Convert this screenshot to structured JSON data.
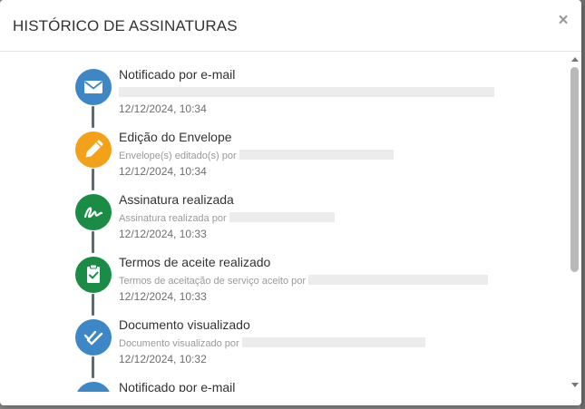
{
  "modal": {
    "title": "HISTÓRICO DE ASSINATURAS",
    "close_label": "×"
  },
  "colors": {
    "blue": "#3d87c6",
    "orange": "#f4a11a",
    "green": "#1a8c45",
    "line": "#5f6b72"
  },
  "events": [
    {
      "title": "Notificado por e-mail",
      "desc_prefix": "",
      "time": "12/12/2024, 10:34",
      "icon": "envelope-icon",
      "color": "#3d87c6"
    },
    {
      "title": "Edição do Envelope",
      "desc_prefix": "Envelope(s) editado(s) por",
      "time": "12/12/2024, 10:34",
      "icon": "pencil-icon",
      "color": "#f4a11a"
    },
    {
      "title": "Assinatura realizada",
      "desc_prefix": "Assinatura realizada por",
      "time": "12/12/2024, 10:33",
      "icon": "signature-icon",
      "color": "#1a8c45"
    },
    {
      "title": "Termos de aceite realizado",
      "desc_prefix": "Termos de aceitação de serviço aceito por",
      "time": "12/12/2024, 10:33",
      "icon": "clipboard-check-icon",
      "color": "#1a8c45"
    },
    {
      "title": "Documento visualizado",
      "desc_prefix": "Documento visualizado por",
      "time": "12/12/2024, 10:32",
      "icon": "double-check-icon",
      "color": "#3d87c6"
    },
    {
      "title": "Notificado por e-mail",
      "desc_prefix": "",
      "time": "",
      "icon": "envelope-icon",
      "color": "#3d87c6"
    }
  ]
}
